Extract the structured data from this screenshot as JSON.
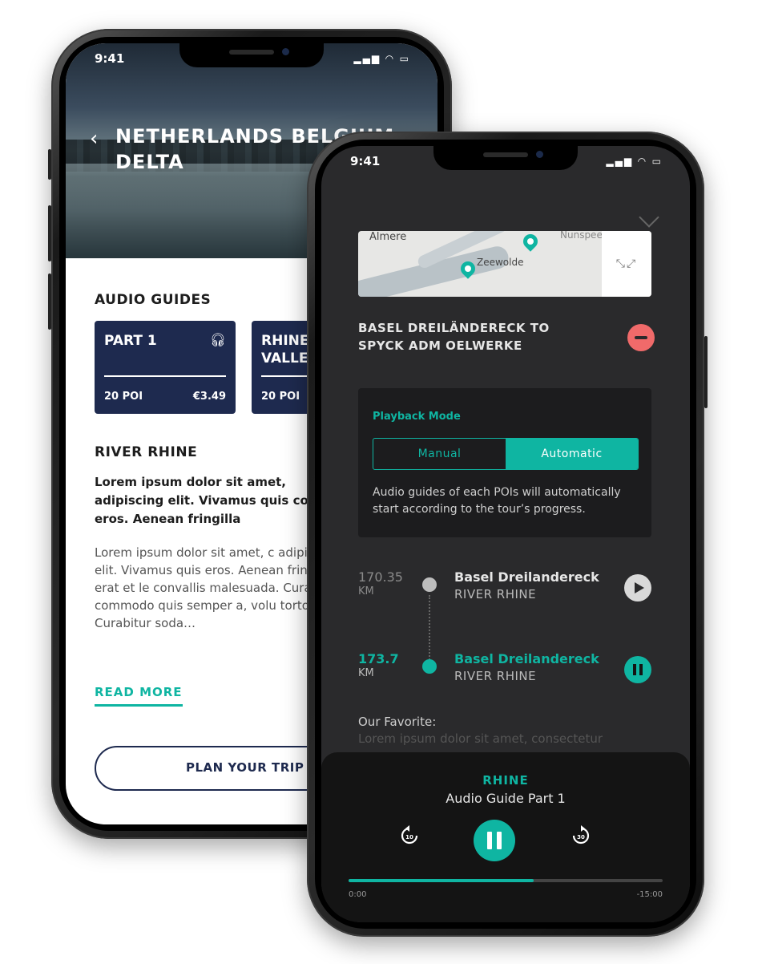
{
  "status_bar": {
    "time": "9:41"
  },
  "left_screen": {
    "hero_title": "NETHERLANDS BELGIUM DELTA",
    "audio_guides_heading": "AUDIO GUIDES",
    "cards": [
      {
        "title": "PART 1",
        "poi": "20 POI",
        "price": "€3.49"
      },
      {
        "title": "RHINE VALLEY",
        "poi": "20 POI",
        "price": ""
      }
    ],
    "river_heading": "RIVER RHINE",
    "lead_text": "Lorem ipsum dolor sit amet, adipiscing elit. Vivamus quis corper eros. Aenean fringilla",
    "body_text": "Lorem ipsum dolor sit amet, c adipiscing elit. Vivamus quis eros. Aenean fringilla erat et le convallis malesuada. Curabitu commodo quis semper a, volu tortor. Curabitur soda…",
    "read_more": "READ MORE",
    "plan_button": "PLAN YOUR TRIP"
  },
  "right_screen": {
    "map": {
      "labels": [
        "Almere",
        "Zeewolde",
        "Nunspeet"
      ]
    },
    "route_title": "BASEL DREILÄNDERECK TO SPYCK ADM OELWERKE",
    "playback": {
      "label": "Playback Mode",
      "options": [
        "Manual",
        "Automatic"
      ],
      "selected": "Automatic",
      "description": "Audio guides of each POIs will automatically start according to the tour’s progress."
    },
    "stops": [
      {
        "km": "170.35",
        "unit": "KM",
        "name": "Basel Dreilandereck",
        "river": "RIVER RHINE",
        "state": "play"
      },
      {
        "km": "173.7",
        "unit": "KM",
        "name": "Basel Dreilandereck",
        "river": "RIVER RHINE",
        "state": "pause"
      }
    ],
    "favorite_label": "Our Favorite:",
    "favorite_text": "Lorem ipsum dolor sit amet, consectetur",
    "player": {
      "title": "RHINE",
      "subtitle": "Audio Guide Part 1",
      "rewind_label": "10",
      "forward_label": "30",
      "progress": 0.59,
      "time_elapsed": "0:00",
      "time_remaining": "-15:00"
    }
  },
  "colors": {
    "accent": "#0fb5a2",
    "navy": "#1e2a4f",
    "danger": "#f06a6a",
    "dark": "#2a2a2c"
  }
}
